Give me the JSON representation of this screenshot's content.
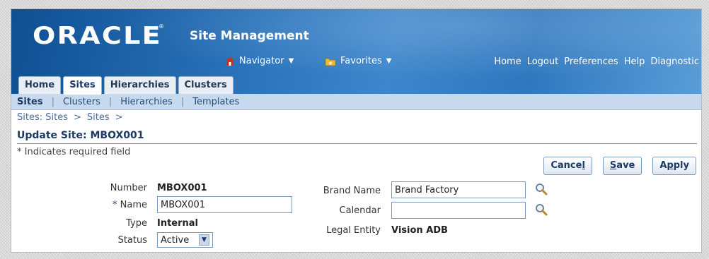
{
  "header": {
    "logo": "ORACLE",
    "logo_mark": "®",
    "app_title": "Site Management",
    "navigator_label": "Navigator",
    "favorites_label": "Favorites",
    "global_links": [
      "Home",
      "Logout",
      "Preferences",
      "Help",
      "Diagnostic"
    ]
  },
  "tabs": [
    {
      "label": "Home",
      "active": false
    },
    {
      "label": "Sites",
      "active": true
    },
    {
      "label": "Hierarchies",
      "active": false
    },
    {
      "label": "Clusters",
      "active": false
    }
  ],
  "subnav": [
    {
      "label": "Sites",
      "active": true
    },
    {
      "label": "Clusters",
      "active": false
    },
    {
      "label": "Hierarchies",
      "active": false
    },
    {
      "label": "Templates",
      "active": false
    }
  ],
  "breadcrumb": {
    "items": [
      "Sites: Sites",
      "Sites"
    ],
    "separator": ">"
  },
  "page": {
    "title": "Update Site: MBOX001",
    "required_note": "* Indicates required field"
  },
  "actions": {
    "cancel_pre": "Cance",
    "cancel_access": "l",
    "save_access": "S",
    "save_post": "ave",
    "apply_pre": "A",
    "apply_access": "p",
    "apply_post": "ply"
  },
  "form": {
    "number_label": "Number",
    "number_value": "MBOX001",
    "required_star": "*",
    "name_label": "Name",
    "name_value": "MBOX001",
    "type_label": "Type",
    "type_value": "Internal",
    "status_label": "Status",
    "status_value": "Active",
    "brand_label": "Brand Name",
    "brand_value": "Brand Factory",
    "calendar_label": "Calendar",
    "calendar_value": "",
    "legal_label": "Legal Entity",
    "legal_value": "Vision ADB"
  },
  "colors": {
    "banner": "#2b74bb",
    "subnav": "#c7d9ec",
    "title": "#1d3a66",
    "link": "#244a7a"
  }
}
